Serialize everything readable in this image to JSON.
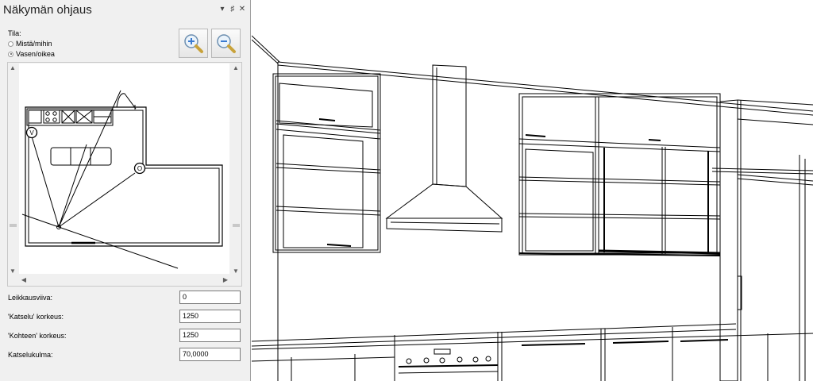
{
  "panel": {
    "title": "Näkymän ohjaus",
    "title_buttons": [
      "▾",
      "♯",
      "✕"
    ]
  },
  "mode": {
    "label": "Tila:",
    "options": [
      {
        "label": "Mistä/mihin",
        "checked": false
      },
      {
        "label": "Vasen/oikea",
        "checked": true
      }
    ]
  },
  "zoom": {
    "in_icon": "zoom-in-icon",
    "out_icon": "zoom-out-icon"
  },
  "plan": {
    "markers": [
      "V",
      "O"
    ],
    "scroll_icons": {
      "up": "▲",
      "down": "▼",
      "left": "◀",
      "right": "▶"
    }
  },
  "fields": {
    "section_line": {
      "label": "Leikkausviiva:",
      "value": "0"
    },
    "viewer_height": {
      "label": "'Katselu' korkeus:",
      "value": "1250"
    },
    "target_height": {
      "label": "'Kohteen' korkeus:",
      "value": "1250"
    },
    "view_angle": {
      "label": "Katselukulma:",
      "value": "70,0000"
    }
  },
  "colors": {
    "panel_bg": "#f0f0f0",
    "line": "#000000",
    "zoom_lens": "#c8a23a"
  }
}
